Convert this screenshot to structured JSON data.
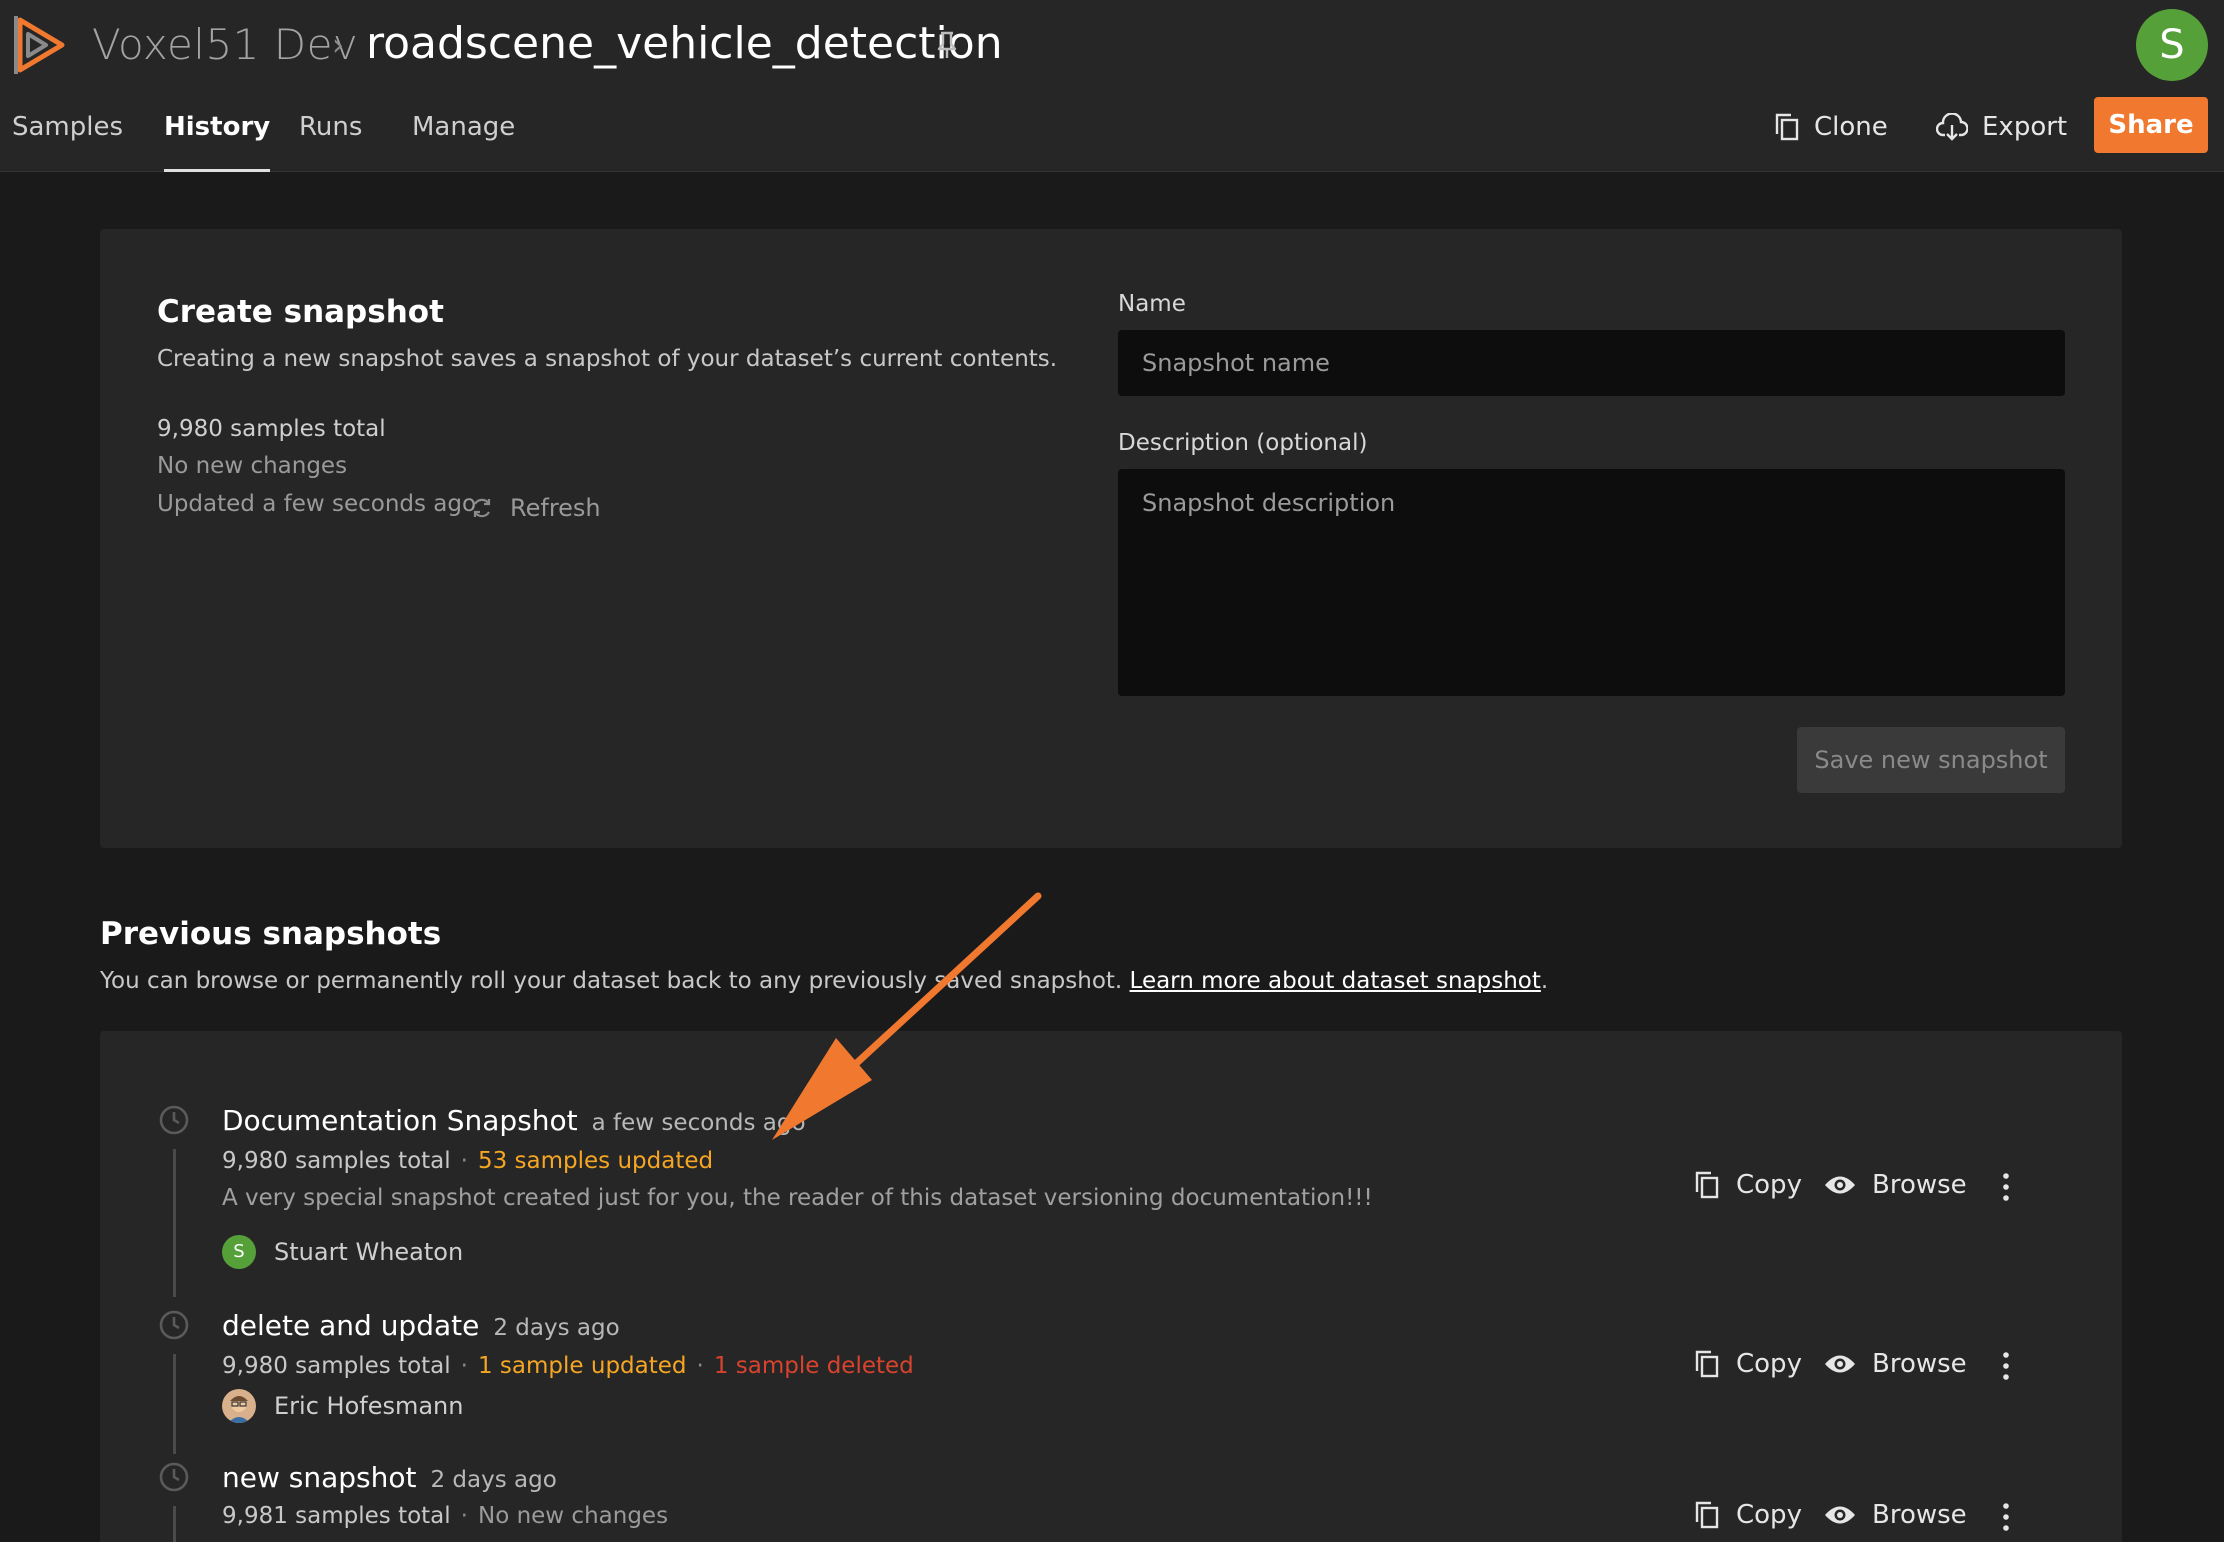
{
  "header": {
    "org": "Voxel51 Dev",
    "separator": "›",
    "dataset": "roadscene_vehicle_detection",
    "avatar_initial": "S"
  },
  "tabs": [
    {
      "label": "Samples"
    },
    {
      "label": "History",
      "active": true
    },
    {
      "label": "Runs"
    },
    {
      "label": "Manage"
    }
  ],
  "actions": {
    "clone": "Clone",
    "export": "Export",
    "share": "Share"
  },
  "create_snapshot": {
    "title": "Create snapshot",
    "description": "Creating a new snapshot saves a snapshot of your dataset’s current contents.",
    "samples_total": "9,980 samples total",
    "changes": "No new changes",
    "updated": "Updated a few seconds ago",
    "refresh": "Refresh",
    "name_label": "Name",
    "name_placeholder": "Snapshot name",
    "description_label": "Description (optional)",
    "description_placeholder": "Snapshot description",
    "save": "Save new snapshot"
  },
  "previous": {
    "title": "Previous snapshots",
    "description": "You can browse or permanently roll your dataset back to any previously saved snapshot. ",
    "link": "Learn more about dataset snapshot",
    "link_suffix": "."
  },
  "snapshots": [
    {
      "name": "Documentation Snapshot",
      "time": "a few seconds ago",
      "total": "9,980 samples total",
      "updated": "53 samples updated",
      "note": "A very special snapshot created just for you, the reader of this dataset versioning documentation!!!",
      "author": "Stuart Wheaton",
      "author_initial": "S"
    },
    {
      "name": "delete and update",
      "time": "2 days ago",
      "total": "9,980 samples total",
      "updated": "1 sample updated",
      "deleted": "1 sample deleted",
      "author": "Eric Hofesmann"
    },
    {
      "name": "new snapshot",
      "time": "2 days ago",
      "total": "9,981 samples total",
      "changes": "No new changes"
    }
  ],
  "row_actions": {
    "copy": "Copy",
    "browse": "Browse"
  },
  "colors": {
    "accent": "#f0782f",
    "updated": "#f5a623",
    "deleted": "#d9432e",
    "avatar": "#56a03a"
  }
}
